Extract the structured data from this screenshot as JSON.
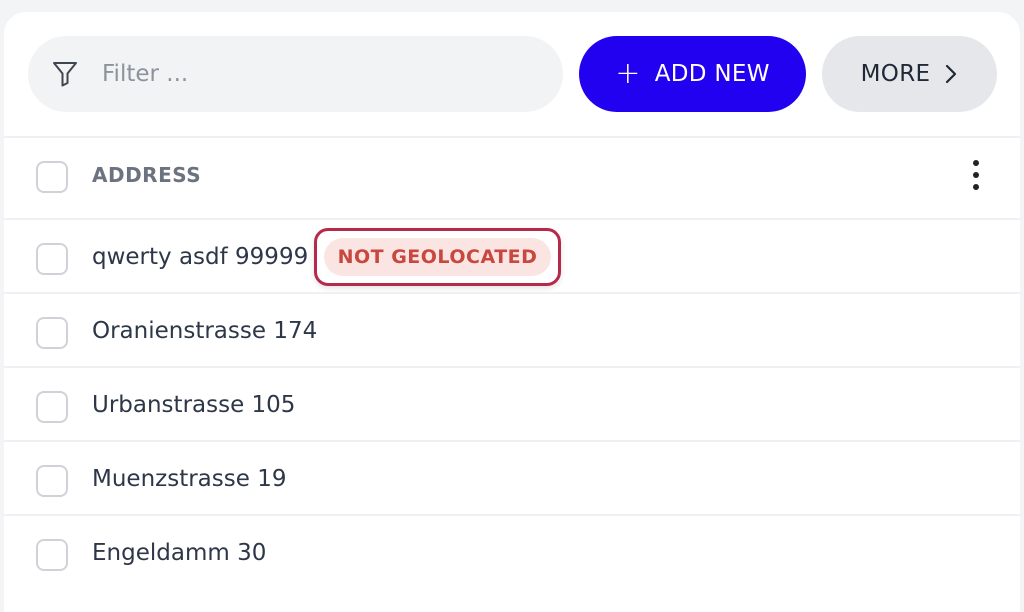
{
  "filter": {
    "placeholder": "Filter ..."
  },
  "toolbar": {
    "add_label": "ADD NEW",
    "more_label": "MORE"
  },
  "table": {
    "column_header": "ADDRESS",
    "rows": [
      {
        "address": "qwerty asdf 99999",
        "badge": "NOT GEOLOCATED"
      },
      {
        "address": "Oranienstrasse 174"
      },
      {
        "address": "Urbanstrasse 105"
      },
      {
        "address": "Muenzstrasse 19"
      },
      {
        "address": "Engeldamm 30"
      }
    ]
  },
  "colors": {
    "accent": "#2200f0",
    "badge_text": "#c8473f",
    "badge_bg": "#fbe5e3",
    "badge_outline": "#b52a4a"
  }
}
